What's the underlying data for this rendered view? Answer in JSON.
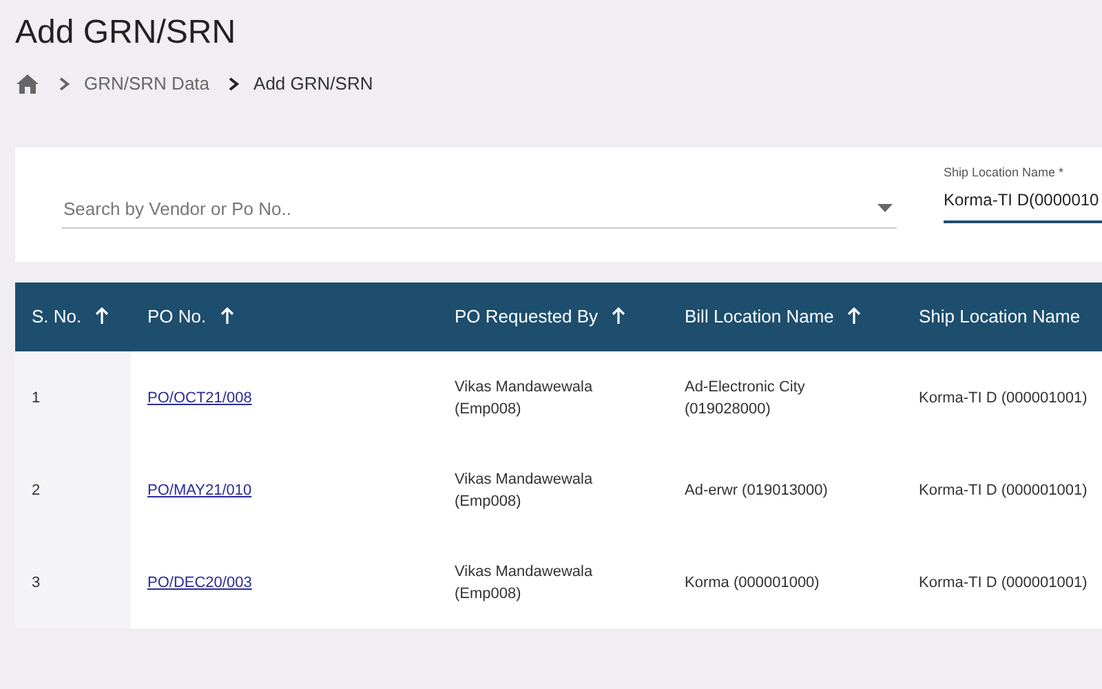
{
  "page_title": "Add GRN/SRN",
  "breadcrumb": [
    {
      "label": "GRN/SRN Data",
      "current": false
    },
    {
      "label": "Add GRN/SRN",
      "current": true
    }
  ],
  "search": {
    "placeholder": "Search by Vendor or Po No.."
  },
  "ship_location": {
    "label": "Ship Location Name *",
    "value": "Korma-TI D(0000010"
  },
  "table": {
    "columns": [
      "S. No.",
      "PO No.",
      "PO Requested By",
      "Bill Location Name",
      "Ship Location Name"
    ],
    "rows": [
      {
        "s_no": "1",
        "po_no": "PO/OCT21/008",
        "requested_by": "Vikas Mandawewala (Emp008)",
        "bill_location": "Ad-Electronic City (019028000)",
        "ship_location": "Korma-TI D (000001001)"
      },
      {
        "s_no": "2",
        "po_no": "PO/MAY21/010",
        "requested_by": "Vikas Mandawewala (Emp008)",
        "bill_location": "Ad-erwr (019013000)",
        "ship_location": "Korma-TI D (000001001)"
      },
      {
        "s_no": "3",
        "po_no": "PO/DEC20/003",
        "requested_by": "Vikas Mandawewala (Emp008)",
        "bill_location": "Korma (000001000)",
        "ship_location": "Korma-TI D (000001001)"
      }
    ]
  }
}
